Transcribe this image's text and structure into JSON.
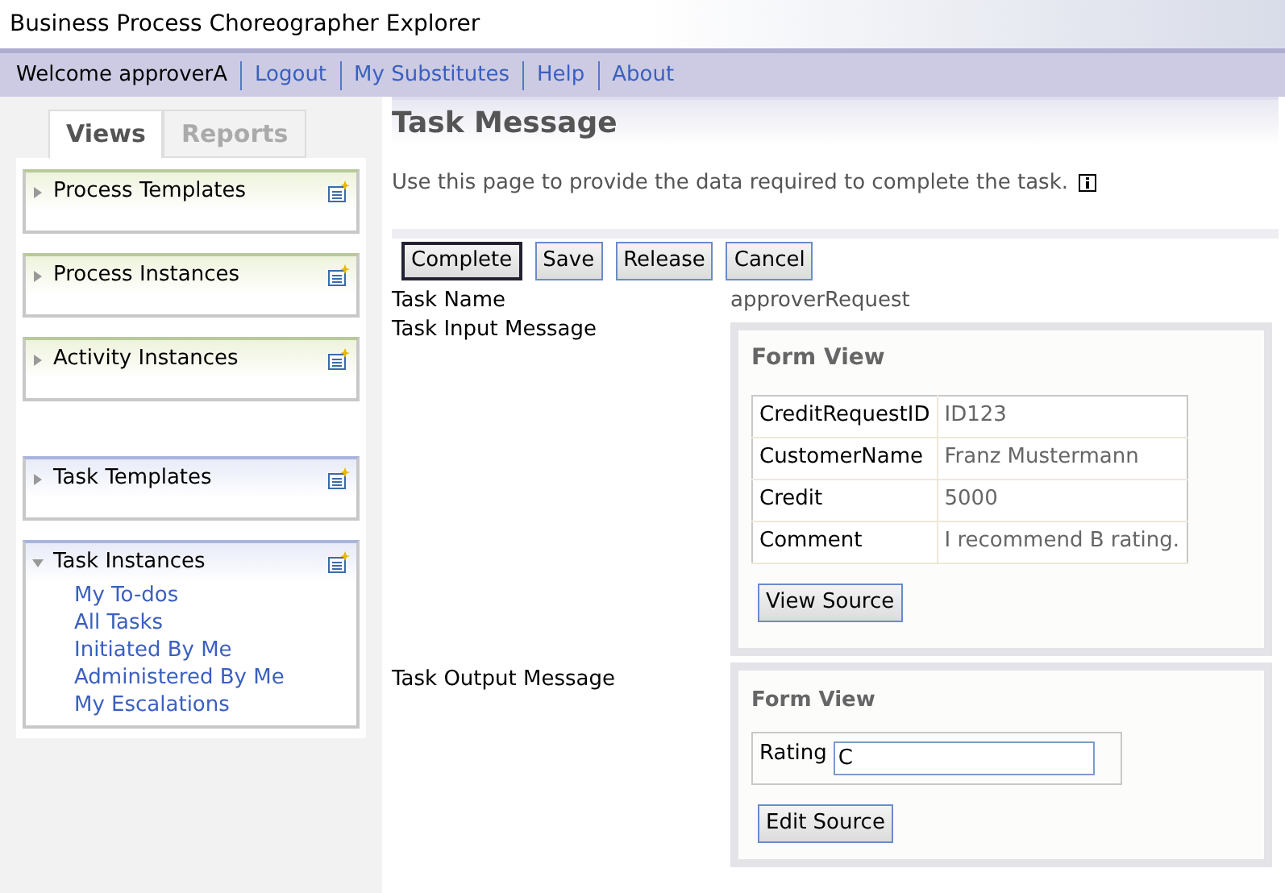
{
  "window": {
    "title": "Business Process Choreographer Explorer"
  },
  "nav": {
    "welcome": "Welcome approverA",
    "links": [
      "Logout",
      "My Substitutes",
      "Help",
      "About"
    ]
  },
  "sidebar": {
    "tabs": [
      {
        "label": "Views",
        "selected": true
      },
      {
        "label": "Reports",
        "selected": false
      }
    ],
    "sections": [
      {
        "groups": [
          {
            "label": "Process Templates",
            "kind": "process",
            "expanded": false
          },
          {
            "label": "Process Instances",
            "kind": "process",
            "expanded": false
          },
          {
            "label": "Activity Instances",
            "kind": "process",
            "expanded": false
          }
        ]
      },
      {
        "groups": [
          {
            "label": "Task Templates",
            "kind": "task",
            "expanded": false
          },
          {
            "label": "Task Instances",
            "kind": "task",
            "expanded": true,
            "children": [
              "My To-dos",
              "All Tasks",
              "Initiated By Me",
              "Administered By Me",
              "My Escalations"
            ]
          }
        ]
      }
    ]
  },
  "page": {
    "title": "Task Message",
    "description": "Use this page to provide the data required to complete the task.",
    "buttons": [
      {
        "label": "Complete",
        "focused": true
      },
      {
        "label": "Save",
        "focused": false
      },
      {
        "label": "Release",
        "focused": false
      },
      {
        "label": "Cancel",
        "focused": false
      }
    ],
    "task_name_label": "Task Name",
    "task_name": "approverRequest",
    "input_label": "Task Input Message",
    "input_form": {
      "title": "Form View",
      "rows": [
        {
          "field": "CreditRequestID",
          "value": "ID123"
        },
        {
          "field": "CustomerName",
          "value": "Franz Mustermann"
        },
        {
          "field": "Credit",
          "value": "5000"
        },
        {
          "field": "Comment",
          "value": "I recommend B rating."
        }
      ],
      "button": "View Source"
    },
    "output_label": "Task Output Message",
    "output_form": {
      "title": "Form View",
      "field": "Rating",
      "value": "C",
      "button": "Edit Source"
    }
  }
}
